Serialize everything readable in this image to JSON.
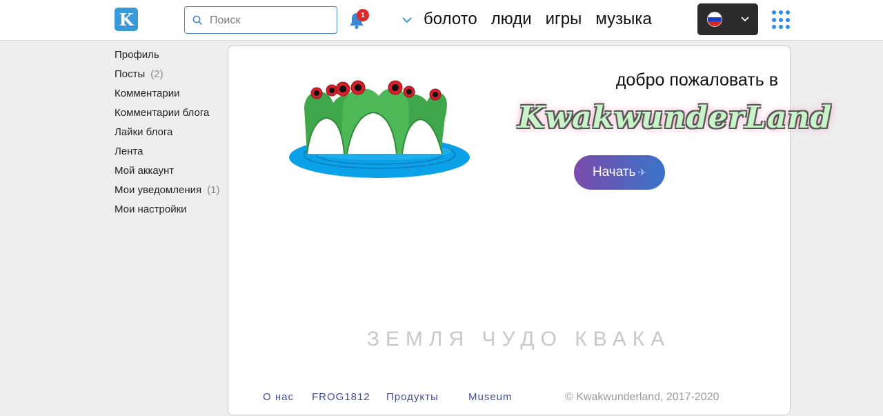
{
  "header": {
    "logo_letter": "K",
    "search": {
      "placeholder": "Поиск",
      "value": ""
    },
    "notifications": {
      "count": "1"
    },
    "nav": [
      "болото",
      "люди",
      "игры",
      "музыка"
    ],
    "language": "ru"
  },
  "sidebar": {
    "items": [
      {
        "label": "Профиль",
        "count": ""
      },
      {
        "label": "Посты",
        "count": "(2)"
      },
      {
        "label": "Комментарии",
        "count": ""
      },
      {
        "label": "Комментарии блога",
        "count": ""
      },
      {
        "label": "Лайки блога",
        "count": ""
      },
      {
        "label": "Лента",
        "count": ""
      },
      {
        "label": "Мой аккаунт",
        "count": ""
      },
      {
        "label": "Мои уведомления",
        "count": "(1)"
      },
      {
        "label": "Мои настройки",
        "count": ""
      }
    ]
  },
  "main": {
    "welcome": "добро пожаловать в",
    "brand": "KwakwunderLand",
    "start_label": "Начать",
    "subtitle": "ЗЕМЛЯ ЧУДО КВАКА",
    "footer": {
      "links": [
        "О нас",
        "FROG1812",
        "Продукты",
        "Museum"
      ],
      "copyright": "© Kwakwunderland, 2017-2020"
    }
  },
  "colors": {
    "accent": "#3a9ad9",
    "badge": "#e02626",
    "button_gradient_start": "#7b4bab",
    "button_gradient_end": "#3b73c8",
    "footer_link": "#444b9a"
  },
  "icons": [
    "search-icon",
    "bell-icon",
    "chevron-down-icon",
    "russia-flag-icon",
    "apps-grid-icon",
    "rocket-icon"
  ]
}
